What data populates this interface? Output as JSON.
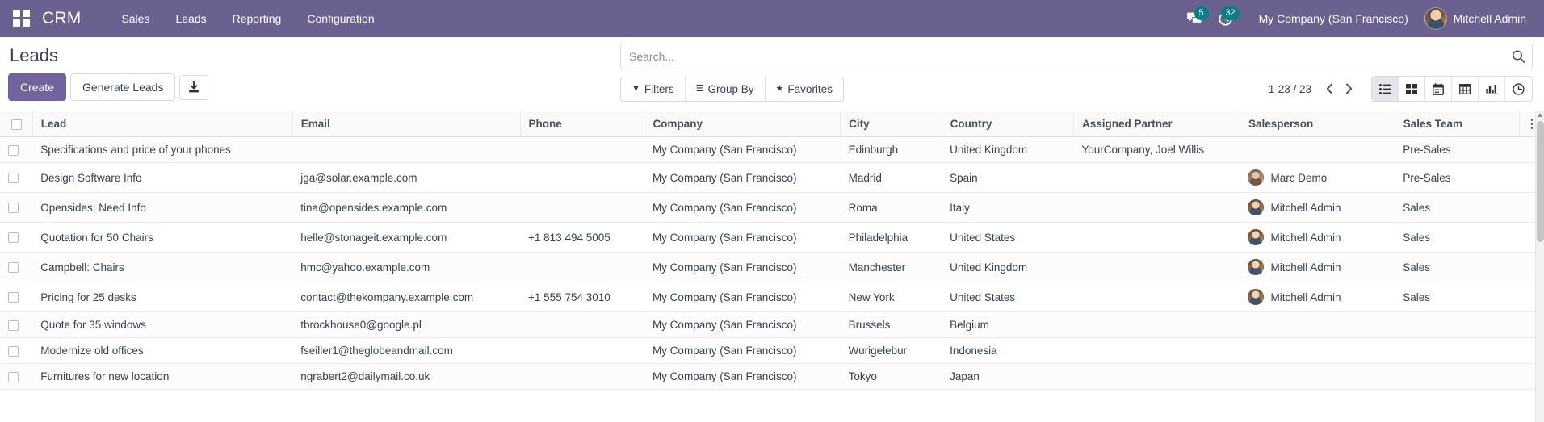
{
  "navbar": {
    "apps_icon": "apps-grid-icon",
    "brand": "CRM",
    "menu": [
      {
        "label": "Sales"
      },
      {
        "label": "Leads"
      },
      {
        "label": "Reporting"
      },
      {
        "label": "Configuration"
      }
    ],
    "messages_badge": "5",
    "activities_badge": "32",
    "company": "My Company (San Francisco)",
    "user": "Mitchell Admin"
  },
  "control_panel": {
    "title": "Leads",
    "create_label": "Create",
    "generate_leads_label": "Generate Leads",
    "import_icon": "import-download-icon",
    "search_placeholder": "Search...",
    "search_value": "",
    "filters_label": "Filters",
    "group_by_label": "Group By",
    "favorites_label": "Favorites",
    "pager": "1-23 / 23",
    "views": [
      {
        "name": "list",
        "icon": "list-view-icon",
        "active": true
      },
      {
        "name": "kanban",
        "icon": "kanban-view-icon",
        "active": false
      },
      {
        "name": "calendar",
        "icon": "calendar-view-icon",
        "active": false
      },
      {
        "name": "pivot",
        "icon": "pivot-view-icon",
        "active": false
      },
      {
        "name": "graph",
        "icon": "graph-view-icon",
        "active": false
      },
      {
        "name": "activity",
        "icon": "activity-view-icon",
        "active": false
      }
    ]
  },
  "table": {
    "columns": [
      "Lead",
      "Email",
      "Phone",
      "Company",
      "City",
      "Country",
      "Assigned Partner",
      "Salesperson",
      "Sales Team"
    ],
    "rows": [
      {
        "lead": "Specifications and price of your phones",
        "email": "",
        "phone": "",
        "company": "My Company (San Francisco)",
        "city": "Edinburgh",
        "country": "United Kingdom",
        "assigned_partner": "YourCompany, Joel Willis",
        "salesperson": "",
        "salesperson_avatar": "",
        "sales_team": "Pre-Sales"
      },
      {
        "lead": "Design Software Info",
        "email": "jga@solar.example.com",
        "phone": "",
        "company": "My Company (San Francisco)",
        "city": "Madrid",
        "country": "Spain",
        "assigned_partner": "",
        "salesperson": "Marc Demo",
        "salesperson_avatar": "marc",
        "sales_team": "Pre-Sales"
      },
      {
        "lead": "Opensides: Need Info",
        "email": "tina@opensides.example.com",
        "phone": "",
        "company": "My Company (San Francisco)",
        "city": "Roma",
        "country": "Italy",
        "assigned_partner": "",
        "salesperson": "Mitchell Admin",
        "salesperson_avatar": "mitchell",
        "sales_team": "Sales"
      },
      {
        "lead": "Quotation for 50 Chairs",
        "email": "helle@stonageit.example.com",
        "phone": "+1 813 494 5005",
        "company": "My Company (San Francisco)",
        "city": "Philadelphia",
        "country": "United States",
        "assigned_partner": "",
        "salesperson": "Mitchell Admin",
        "salesperson_avatar": "mitchell",
        "sales_team": "Sales"
      },
      {
        "lead": "Campbell: Chairs",
        "email": "hmc@yahoo.example.com",
        "phone": "",
        "company": "My Company (San Francisco)",
        "city": "Manchester",
        "country": "United Kingdom",
        "assigned_partner": "",
        "salesperson": "Mitchell Admin",
        "salesperson_avatar": "mitchell",
        "sales_team": "Sales"
      },
      {
        "lead": "Pricing for 25 desks",
        "email": "contact@thekompany.example.com",
        "phone": "+1 555 754 3010",
        "company": "My Company (San Francisco)",
        "city": "New York",
        "country": "United States",
        "assigned_partner": "",
        "salesperson": "Mitchell Admin",
        "salesperson_avatar": "mitchell",
        "sales_team": "Sales"
      },
      {
        "lead": "Quote for 35 windows",
        "email": "tbrockhouse0@google.pl",
        "phone": "",
        "company": "My Company (San Francisco)",
        "city": "Brussels",
        "country": "Belgium",
        "assigned_partner": "",
        "salesperson": "",
        "salesperson_avatar": "",
        "sales_team": ""
      },
      {
        "lead": "Modernize old offices",
        "email": "fseiller1@theglobeandmail.com",
        "phone": "",
        "company": "My Company (San Francisco)",
        "city": "Wurigelebur",
        "country": "Indonesia",
        "assigned_partner": "",
        "salesperson": "",
        "salesperson_avatar": "",
        "sales_team": ""
      },
      {
        "lead": "Furnitures for new location",
        "email": "ngrabert2@dailymail.co.uk",
        "phone": "",
        "company": "My Company (San Francisco)",
        "city": "Tokyo",
        "country": "Japan",
        "assigned_partner": "",
        "salesperson": "",
        "salesperson_avatar": "",
        "sales_team": ""
      }
    ]
  },
  "colors": {
    "navbar": "#6b6190",
    "primary": "#71639e",
    "badge": "#00808a"
  }
}
